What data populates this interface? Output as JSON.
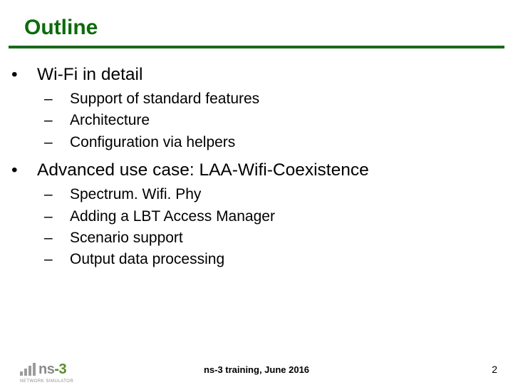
{
  "title": "Outline",
  "sections": [
    {
      "label": "Wi-Fi in detail",
      "items": [
        "Support of standard features",
        "Architecture",
        "Configuration via helpers"
      ]
    },
    {
      "label": "Advanced use case:  LAA-Wifi-Coexistence",
      "items": [
        "Spectrum. Wifi. Phy",
        "Adding a LBT Access Manager",
        "Scenario support",
        "Output data processing"
      ]
    }
  ],
  "logo": {
    "prefix": "ns",
    "suffix": "-3",
    "subtitle": "NETWORK SIMULATOR"
  },
  "footer_center": "ns-3 training, June 2016",
  "page_number": "2"
}
